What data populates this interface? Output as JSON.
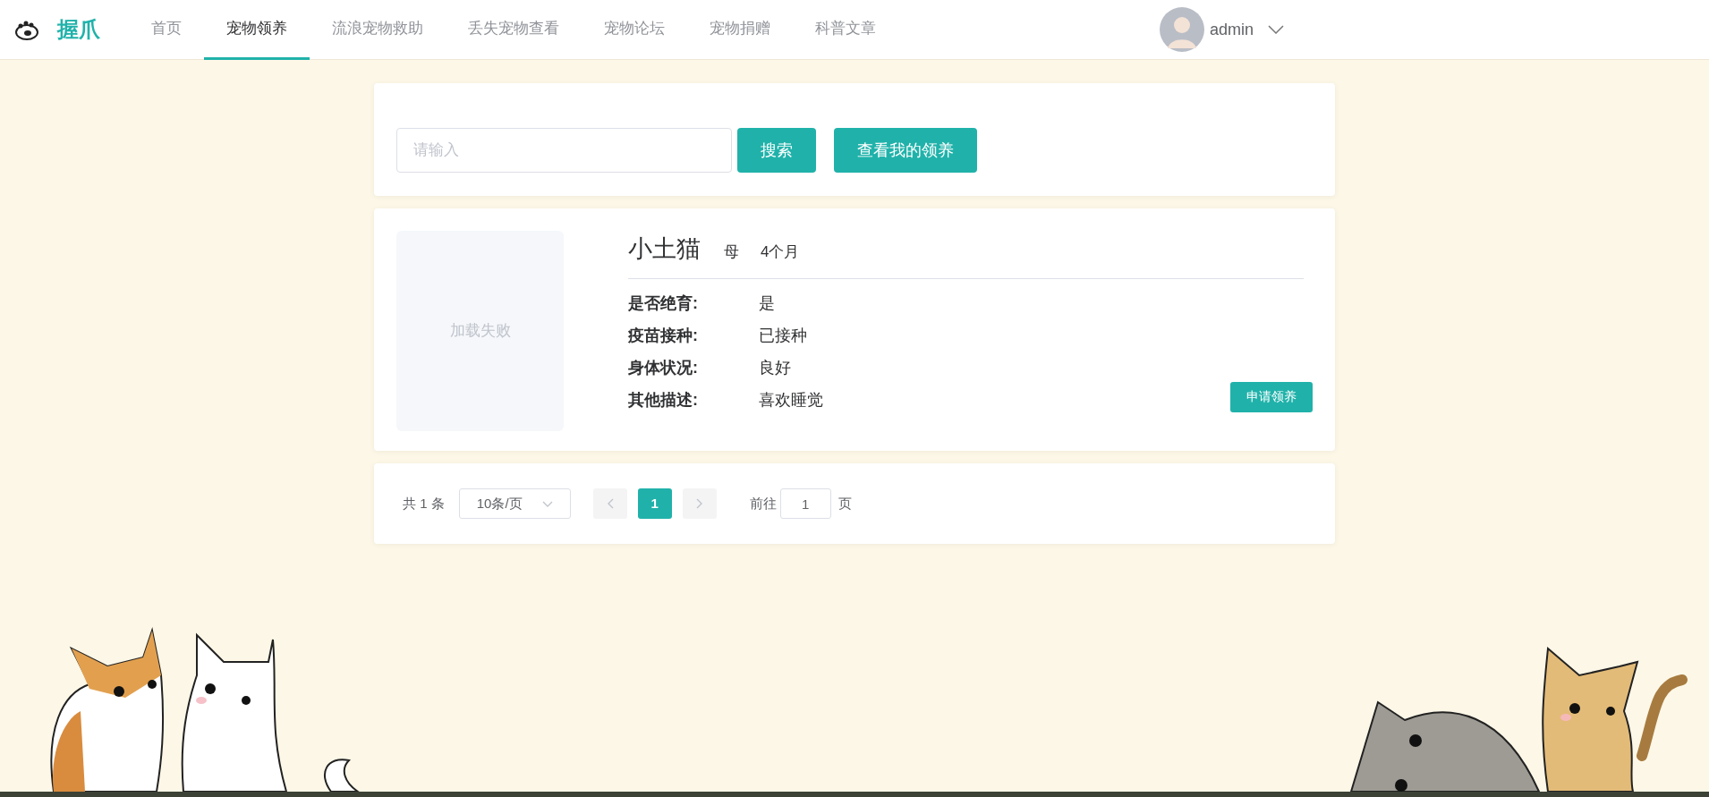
{
  "brand": "握爪",
  "nav": [
    {
      "label": "首页",
      "selected": false
    },
    {
      "label": "宠物领养",
      "selected": true
    },
    {
      "label": "流浪宠物救助",
      "selected": false
    },
    {
      "label": "丢失宠物查看",
      "selected": false
    },
    {
      "label": "宠物论坛",
      "selected": false
    },
    {
      "label": "宠物捐赠",
      "selected": false
    },
    {
      "label": "科普文章",
      "selected": false
    }
  ],
  "user": {
    "name": "admin"
  },
  "search": {
    "placeholder": "请输入",
    "buttons": [
      "搜索",
      "查看我的领养"
    ]
  },
  "pets": [
    {
      "image_status": "加载失败",
      "name": "小土猫",
      "sex": "母",
      "age": "4个月",
      "details": [
        {
          "label": "是否绝育:",
          "value": "是"
        },
        {
          "label": "疫苗接种:",
          "value": "已接种"
        },
        {
          "label": "身体状况:",
          "value": "良好"
        },
        {
          "label": "其他描述:",
          "value": "喜欢睡觉"
        }
      ],
      "action": "申请领养"
    }
  ],
  "pagination": {
    "total": "共 1 条",
    "page_size": "10条/页",
    "prev": {
      "disabled": true
    },
    "next": {
      "disabled": true
    },
    "pages": [
      {
        "label": "1",
        "selected": true
      }
    ],
    "goto_label": "前往",
    "goto_value": "1",
    "goto_suffix": "页"
  }
}
